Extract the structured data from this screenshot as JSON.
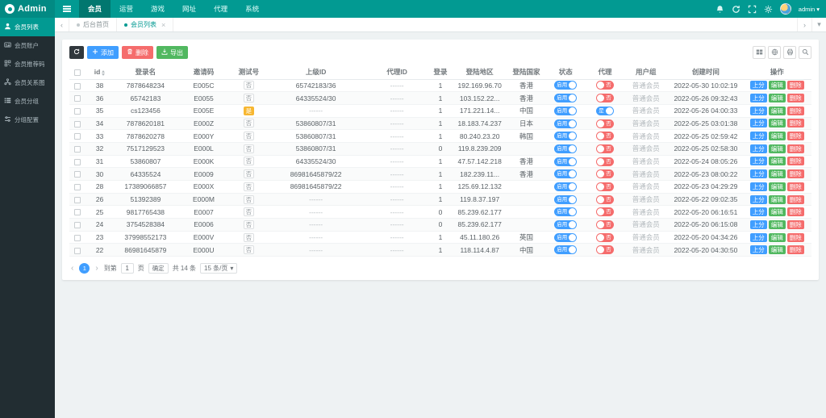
{
  "colors": {
    "teal": "#029a92",
    "teal_dark": "#01776f",
    "sidebar_bg": "#222d32",
    "blue": "#409eff",
    "red": "#f56c6c",
    "green": "#51b860",
    "yellow": "#f7b731"
  },
  "topbar": {
    "brand": "Admin",
    "nav": [
      {
        "label": "会员",
        "active": true
      },
      {
        "label": "运营",
        "active": false
      },
      {
        "label": "游戏",
        "active": false
      },
      {
        "label": "网址",
        "active": false
      },
      {
        "label": "代理",
        "active": false
      },
      {
        "label": "系统",
        "active": false
      }
    ],
    "icons": [
      "bell-icon",
      "refresh-icon",
      "fullscreen-icon",
      "gear-icon"
    ],
    "user": "admin"
  },
  "sidebar": {
    "items": [
      {
        "label": "会员列表",
        "icon": "user",
        "active": true
      },
      {
        "label": "会员账户",
        "icon": "card",
        "active": false
      },
      {
        "label": "会员推荐码",
        "icon": "referral",
        "active": false
      },
      {
        "label": "会员关系图",
        "icon": "relation",
        "active": false
      },
      {
        "label": "会员分组",
        "icon": "group",
        "active": false
      },
      {
        "label": "分组配置",
        "icon": "config",
        "active": false
      }
    ]
  },
  "tabs": {
    "items": [
      {
        "label": "后台首页",
        "active": false,
        "closable": false
      },
      {
        "label": "会员列表",
        "active": true,
        "closable": true
      }
    ]
  },
  "toolbar": {
    "add_label": "添加",
    "delete_label": "删除",
    "export_label": "导出",
    "right_icons": [
      "columns-icon",
      "globe-icon",
      "print-icon",
      "search-icon"
    ]
  },
  "table": {
    "columns": [
      "id",
      "登录名",
      "邀请码",
      "测试号",
      "上级ID",
      "代理ID",
      "登录",
      "登陆地区",
      "登陆国家",
      "状态",
      "代理",
      "用户组",
      "创建时间",
      "操作"
    ],
    "ops": [
      "上分",
      "编辑",
      "删除"
    ],
    "status_on_label": "启用",
    "rows": [
      {
        "id": 38,
        "login": "7878648234",
        "code": "E005C",
        "test": "否",
        "parent": "65742183/36",
        "agent_id": "------",
        "logins": 1,
        "ip": "192.169.96.70",
        "country": "香港",
        "agent": "否",
        "group": "普通会员",
        "created": "2022-05-30 10:02:19"
      },
      {
        "id": 36,
        "login": "65742183",
        "code": "E0055",
        "test": "否",
        "parent": "64335524/30",
        "agent_id": "------",
        "logins": 1,
        "ip": "103.152.22...",
        "country": "香港",
        "agent": "否",
        "group": "普通会员",
        "created": "2022-05-26 09:32:43"
      },
      {
        "id": 35,
        "login": "cs123456",
        "code": "E005E",
        "test": "是",
        "parent": "------",
        "agent_id": "------",
        "logins": 1,
        "ip": "171.221.14...",
        "country": "中国",
        "agent": "是",
        "group": "普通会员",
        "created": "2022-05-26 04:00:33"
      },
      {
        "id": 34,
        "login": "7878620181",
        "code": "E000Z",
        "test": "否",
        "parent": "53860807/31",
        "agent_id": "------",
        "logins": 1,
        "ip": "18.183.74.237",
        "country": "日本",
        "agent": "否",
        "group": "普通会员",
        "created": "2022-05-25 03:01:38"
      },
      {
        "id": 33,
        "login": "7878620278",
        "code": "E000Y",
        "test": "否",
        "parent": "53860807/31",
        "agent_id": "------",
        "logins": 1,
        "ip": "80.240.23.20",
        "country": "韩国",
        "agent": "否",
        "group": "普通会员",
        "created": "2022-05-25 02:59:42"
      },
      {
        "id": 32,
        "login": "7517129523",
        "code": "E000L",
        "test": "否",
        "parent": "53860807/31",
        "agent_id": "------",
        "logins": 0,
        "ip": "119.8.239.209",
        "country": "",
        "agent": "否",
        "group": "普通会员",
        "created": "2022-05-25 02:58:30"
      },
      {
        "id": 31,
        "login": "53860807",
        "code": "E000K",
        "test": "否",
        "parent": "64335524/30",
        "agent_id": "------",
        "logins": 1,
        "ip": "47.57.142.218",
        "country": "香港",
        "agent": "否",
        "group": "普通会员",
        "created": "2022-05-24 08:05:26"
      },
      {
        "id": 30,
        "login": "64335524",
        "code": "E0009",
        "test": "否",
        "parent": "86981645879/22",
        "agent_id": "------",
        "logins": 1,
        "ip": "182.239.11...",
        "country": "香港",
        "agent": "否",
        "group": "普通会员",
        "created": "2022-05-23 08:00:22"
      },
      {
        "id": 28,
        "login": "17389066857",
        "code": "E000X",
        "test": "否",
        "parent": "86981645879/22",
        "agent_id": "------",
        "logins": 1,
        "ip": "125.69.12.132",
        "country": "",
        "agent": "否",
        "group": "普通会员",
        "created": "2022-05-23 04:29:29"
      },
      {
        "id": 26,
        "login": "51392389",
        "code": "E000M",
        "test": "否",
        "parent": "------",
        "agent_id": "------",
        "logins": 1,
        "ip": "119.8.37.197",
        "country": "",
        "agent": "否",
        "group": "普通会员",
        "created": "2022-05-22 09:02:35"
      },
      {
        "id": 25,
        "login": "9817765438",
        "code": "E0007",
        "test": "否",
        "parent": "------",
        "agent_id": "------",
        "logins": 0,
        "ip": "85.239.62.177",
        "country": "",
        "agent": "否",
        "group": "普通会员",
        "created": "2022-05-20 06:16:51"
      },
      {
        "id": 24,
        "login": "3754528384",
        "code": "E0006",
        "test": "否",
        "parent": "------",
        "agent_id": "------",
        "logins": 0,
        "ip": "85.239.62.177",
        "country": "",
        "agent": "否",
        "group": "普通会员",
        "created": "2022-05-20 06:15:08"
      },
      {
        "id": 23,
        "login": "37998552173",
        "code": "E000V",
        "test": "否",
        "parent": "------",
        "agent_id": "------",
        "logins": 1,
        "ip": "45.11.180.26",
        "country": "英国",
        "agent": "否",
        "group": "普通会员",
        "created": "2022-05-20 04:34:26"
      },
      {
        "id": 22,
        "login": "86981645879",
        "code": "E000U",
        "test": "否",
        "parent": "------",
        "agent_id": "------",
        "logins": 1,
        "ip": "118.114.4.87",
        "country": "中国",
        "agent": "否",
        "group": "普通会员",
        "created": "2022-05-20 04:30:50"
      }
    ]
  },
  "pagination": {
    "prev": "‹",
    "next": "›",
    "page": "1",
    "goto_label": "到第",
    "goto_value": "1",
    "page_unit": "页",
    "confirm_label": "确定",
    "total_label": "共 14 条",
    "per_page_label": "15 条/页"
  }
}
